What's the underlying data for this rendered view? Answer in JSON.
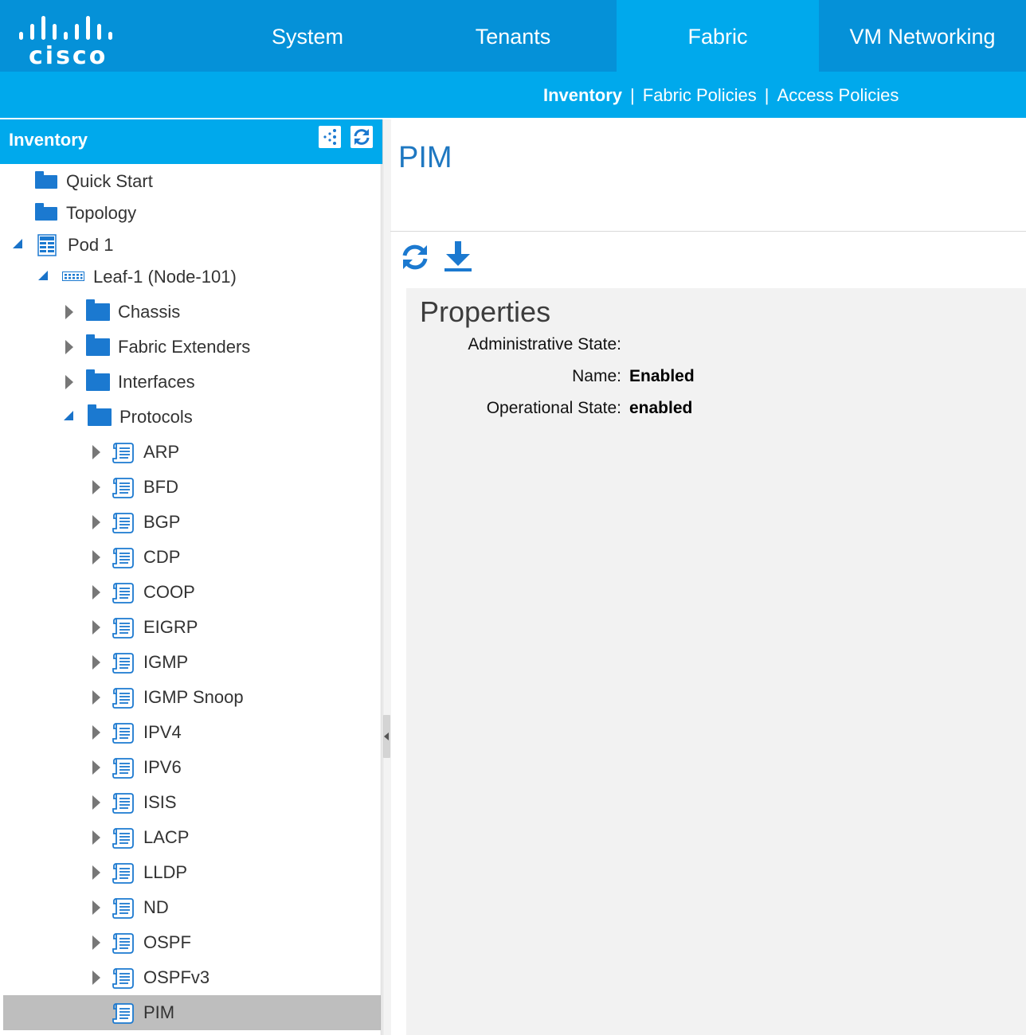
{
  "brand": {
    "logo_text": "cisco",
    "color": "#0591d8",
    "accent": "#00a9ec"
  },
  "nav": {
    "tabs": [
      {
        "label": "System",
        "active": false
      },
      {
        "label": "Tenants",
        "active": false
      },
      {
        "label": "Fabric",
        "active": true
      },
      {
        "label": "VM Networking",
        "active": false
      }
    ]
  },
  "subnav": {
    "items": [
      {
        "label": "Inventory",
        "active": true
      },
      {
        "label": "Fabric Policies",
        "active": false
      },
      {
        "label": "Access Policies",
        "active": false
      }
    ],
    "separator": "|"
  },
  "sidebar": {
    "title": "Inventory",
    "header_buttons": [
      "topology-view-icon",
      "refresh-icon"
    ],
    "tree": [
      {
        "label": "Quick Start",
        "icon": "folder-icon"
      },
      {
        "label": "Topology",
        "icon": "folder-icon"
      },
      {
        "label": "Pod 1",
        "icon": "pod-icon",
        "expanded": true
      },
      {
        "label": "Leaf-1 (Node-101)",
        "icon": "leaf-switch-icon",
        "expanded": true
      },
      {
        "label": "Chassis",
        "icon": "folder-icon",
        "expanded": false
      },
      {
        "label": "Fabric Extenders",
        "icon": "folder-icon",
        "expanded": false
      },
      {
        "label": "Interfaces",
        "icon": "folder-icon",
        "expanded": false
      },
      {
        "label": "Protocols",
        "icon": "folder-icon",
        "expanded": true
      },
      {
        "label": "ARP",
        "icon": "scroll-icon",
        "expanded": false
      },
      {
        "label": "BFD",
        "icon": "scroll-icon",
        "expanded": false
      },
      {
        "label": "BGP",
        "icon": "scroll-icon",
        "expanded": false
      },
      {
        "label": "CDP",
        "icon": "scroll-icon",
        "expanded": false
      },
      {
        "label": "COOP",
        "icon": "scroll-icon",
        "expanded": false
      },
      {
        "label": "EIGRP",
        "icon": "scroll-icon",
        "expanded": false
      },
      {
        "label": "IGMP",
        "icon": "scroll-icon",
        "expanded": false
      },
      {
        "label": "IGMP Snoop",
        "icon": "scroll-icon",
        "expanded": false
      },
      {
        "label": "IPV4",
        "icon": "scroll-icon",
        "expanded": false
      },
      {
        "label": "IPV6",
        "icon": "scroll-icon",
        "expanded": false
      },
      {
        "label": "ISIS",
        "icon": "scroll-icon",
        "expanded": false
      },
      {
        "label": "LACP",
        "icon": "scroll-icon",
        "expanded": false
      },
      {
        "label": "LLDP",
        "icon": "scroll-icon",
        "expanded": false
      },
      {
        "label": "ND",
        "icon": "scroll-icon",
        "expanded": false
      },
      {
        "label": "OSPF",
        "icon": "scroll-icon",
        "expanded": false
      },
      {
        "label": "OSPFv3",
        "icon": "scroll-icon",
        "expanded": false
      },
      {
        "label": "PIM",
        "icon": "scroll-icon",
        "selected": true
      }
    ]
  },
  "main": {
    "title": "PIM",
    "toolbar": [
      "refresh-icon",
      "download-icon"
    ],
    "properties": {
      "heading": "Properties",
      "rows": [
        {
          "label": "Administrative State:",
          "value": ""
        },
        {
          "label": "Name:",
          "value": "Enabled"
        },
        {
          "label": "Operational State:",
          "value": "enabled"
        }
      ]
    }
  }
}
